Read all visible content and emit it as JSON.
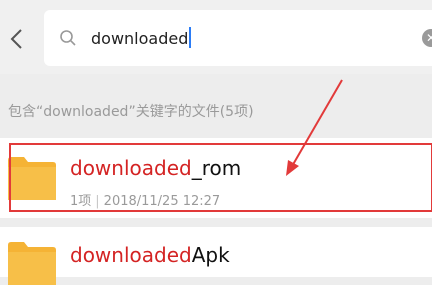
{
  "search": {
    "query": "downloaded"
  },
  "hint": "包含“downloaded”关键字的文件(5项)",
  "results": [
    {
      "name_highlight": "downloaded",
      "name_rest": "_rom",
      "count": "1项",
      "date": "2018/11/25 12:27"
    },
    {
      "name_highlight": "downloaded",
      "name_rest": "Apk"
    }
  ],
  "colors": {
    "highlight": "#d42323",
    "annotation": "#e23a3a",
    "folder": "#f5b335"
  }
}
